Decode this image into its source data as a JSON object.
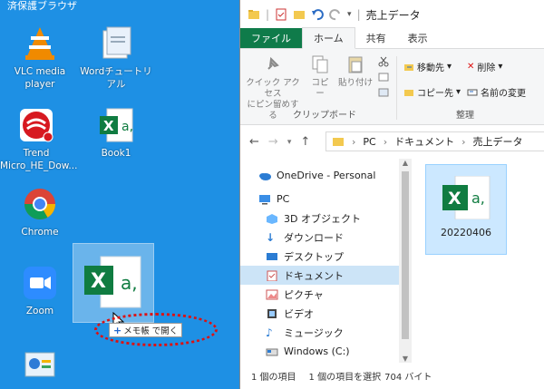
{
  "desktop": {
    "top_label": "済保護ブラウザ",
    "icons": [
      {
        "label": "VLC media player"
      },
      {
        "label": "Wordチュートリアル"
      },
      {
        "label": "Trend Micro_HE_Dow..."
      },
      {
        "label": "Book1"
      },
      {
        "label": "Chrome"
      },
      {
        "label": "Zoom"
      }
    ],
    "drag_tooltip": "メモ帳 で開く"
  },
  "window": {
    "title": "売上データ",
    "tabs": [
      "ファイル",
      "ホーム",
      "共有",
      "表示"
    ],
    "ribbon": {
      "quick_access_label": "クイック アクセス\nにピン留めする",
      "copy_label": "コピー",
      "paste_label": "貼り付け",
      "clipboard_group": "クリップボード",
      "move_to": "移動先",
      "copy_to": "コピー先",
      "delete": "削除",
      "rename": "名前の変更",
      "organize_group": "整理"
    },
    "breadcrumb": [
      "PC",
      "ドキュメント",
      "売上データ"
    ],
    "nav": [
      {
        "label": "OneDrive - Personal"
      },
      {
        "label": "PC"
      },
      {
        "label": "3D オブジェクト"
      },
      {
        "label": "ダウンロード"
      },
      {
        "label": "デスクトップ"
      },
      {
        "label": "ドキュメント"
      },
      {
        "label": "ピクチャ"
      },
      {
        "label": "ビデオ"
      },
      {
        "label": "ミュージック"
      },
      {
        "label": "Windows (C:)"
      }
    ],
    "file": {
      "name": "20220406"
    },
    "status": {
      "items": "1 個の項目",
      "selected": "1 個の項目を選択",
      "size": "704 バイト"
    }
  },
  "colors": {
    "desktop": "#1e90e4",
    "excel_green": "#107c41",
    "selection": "#cce8ff",
    "annotation": "#dd1111"
  }
}
